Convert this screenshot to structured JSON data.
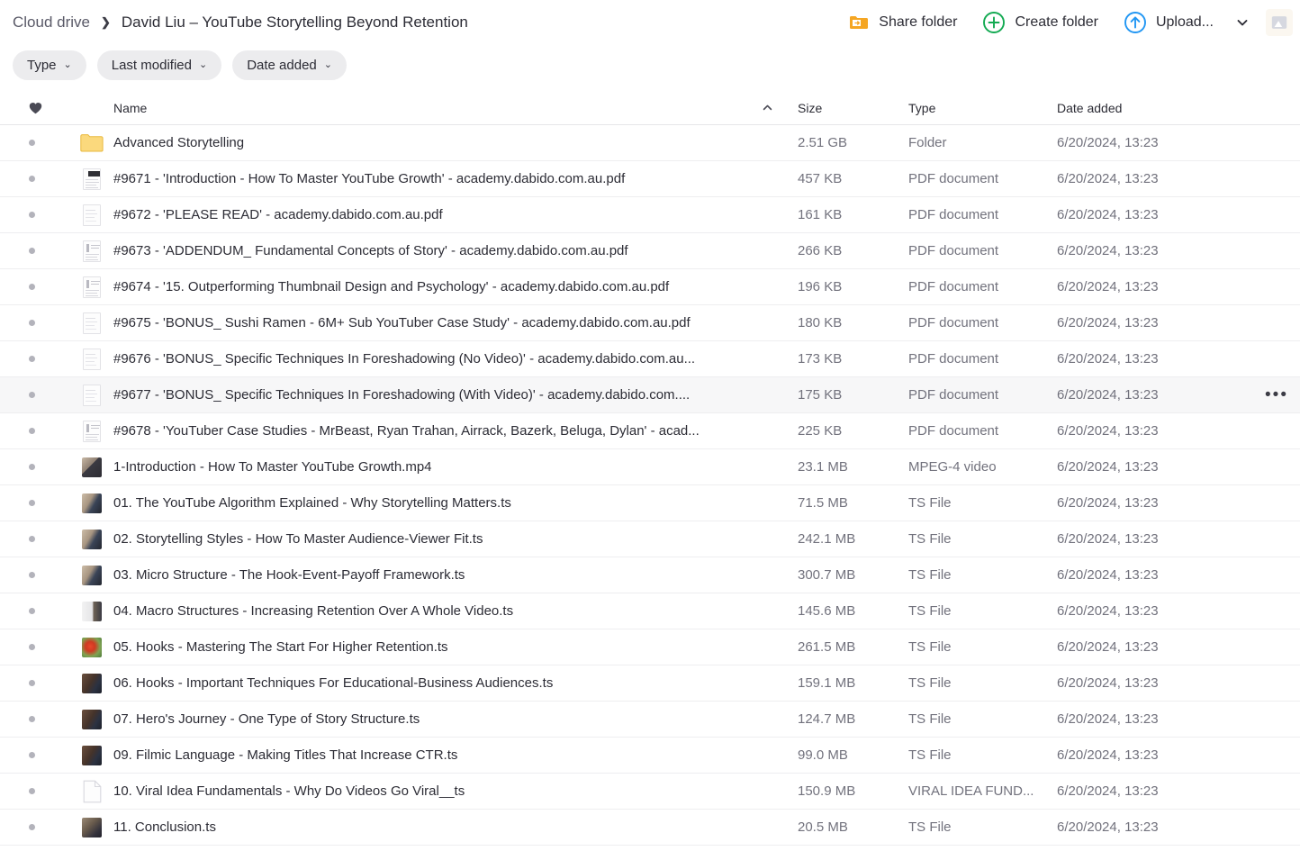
{
  "breadcrumb": {
    "root": "Cloud drive",
    "separator": "❯",
    "current": "David Liu – YouTube Storytelling Beyond Retention"
  },
  "toolbar": {
    "share_label": "Share folder",
    "create_label": "Create folder",
    "upload_label": "Upload...",
    "upload_caret": "⌄",
    "corner_icon": "image-icon",
    "icons": {
      "share": "share-folder-icon",
      "create": "plus-circle-icon",
      "upload": "upload-arrow-circle-icon"
    },
    "colors": {
      "share_accent": "#f5a623",
      "create_accent": "#13aa52",
      "upload_accent": "#2196f3"
    }
  },
  "filters": [
    {
      "label": "Type",
      "caret": "⌄",
      "name": "filter-type"
    },
    {
      "label": "Last modified",
      "caret": "⌄",
      "name": "filter-last-modified"
    },
    {
      "label": "Date added",
      "caret": "⌄",
      "name": "filter-date-added"
    }
  ],
  "table": {
    "headers": {
      "favorite_icon": "heart-icon",
      "name": "Name",
      "sort_indicator": "▲",
      "size": "Size",
      "type": "Type",
      "date_added": "Date added"
    },
    "rows": [
      {
        "name": "Advanced Storytelling",
        "size": "2.51 GB",
        "type": "Folder",
        "date": "6/20/2024, 13:23",
        "icon": "folder",
        "hovered": false
      },
      {
        "name": "#9671 - 'Introduction - How To Master YouTube Growth' - academy.dabido.com.au.pdf",
        "size": "457 KB",
        "type": "PDF document",
        "date": "6/20/2024, 13:23",
        "icon": "doc-dark",
        "hovered": false
      },
      {
        "name": "#9672 - 'PLEASE READ' - academy.dabido.com.au.pdf",
        "size": "161 KB",
        "type": "PDF document",
        "date": "6/20/2024, 13:23",
        "icon": "doc-light",
        "hovered": false
      },
      {
        "name": "#9673 - 'ADDENDUM_ Fundamental Concepts of Story' - academy.dabido.com.au.pdf",
        "size": "266 KB",
        "type": "PDF document",
        "date": "6/20/2024, 13:23",
        "icon": "doc-mid",
        "hovered": false
      },
      {
        "name": "#9674 - '15. Outperforming Thumbnail Design and Psychology' - academy.dabido.com.au.pdf",
        "size": "196 KB",
        "type": "PDF document",
        "date": "6/20/2024, 13:23",
        "icon": "doc-mid",
        "hovered": false
      },
      {
        "name": "#9675 - 'BONUS_ Sushi Ramen - 6M+ Sub YouTuber Case Study' - academy.dabido.com.au.pdf",
        "size": "180 KB",
        "type": "PDF document",
        "date": "6/20/2024, 13:23",
        "icon": "doc-light",
        "hovered": false
      },
      {
        "name": "#9676 - 'BONUS_ Specific Techniques In Foreshadowing (No Video)' - academy.dabido.com.au...",
        "size": "173 KB",
        "type": "PDF document",
        "date": "6/20/2024, 13:23",
        "icon": "doc-light",
        "hovered": false
      },
      {
        "name": "#9677 - 'BONUS_ Specific Techniques In Foreshadowing (With Video)' - academy.dabido.com....",
        "size": "175 KB",
        "type": "PDF document",
        "date": "6/20/2024, 13:23",
        "icon": "doc-light",
        "hovered": true
      },
      {
        "name": "#9678 - 'YouTuber Case Studies - MrBeast, Ryan Trahan, Airrack, Bazerk, Beluga, Dylan' - acad...",
        "size": "225 KB",
        "type": "PDF document",
        "date": "6/20/2024, 13:23",
        "icon": "doc-mid",
        "hovered": false
      },
      {
        "name": "1-Introduction - How To Master YouTube Growth.mp4",
        "size": "23.1 MB",
        "type": "MPEG-4 video",
        "date": "6/20/2024, 13:23",
        "icon": "video-a",
        "hovered": false
      },
      {
        "name": "01. The YouTube Algorithm Explained - Why Storytelling Matters.ts",
        "size": "71.5 MB",
        "type": "TS File",
        "date": "6/20/2024, 13:23",
        "icon": "video-b",
        "hovered": false
      },
      {
        "name": "02. Storytelling Styles - How To Master Audience-Viewer Fit.ts",
        "size": "242.1 MB",
        "type": "TS File",
        "date": "6/20/2024, 13:23",
        "icon": "video-b",
        "hovered": false
      },
      {
        "name": "03. Micro Structure - The Hook-Event-Payoff Framework.ts",
        "size": "300.7 MB",
        "type": "TS File",
        "date": "6/20/2024, 13:23",
        "icon": "video-b",
        "hovered": false
      },
      {
        "name": "04. Macro Structures - Increasing Retention Over A Whole Video.ts",
        "size": "145.6 MB",
        "type": "TS File",
        "date": "6/20/2024, 13:23",
        "icon": "video-white",
        "hovered": false
      },
      {
        "name": "05. Hooks - Mastering The Start For Higher Retention.ts",
        "size": "261.5 MB",
        "type": "TS File",
        "date": "6/20/2024, 13:23",
        "icon": "video-red",
        "hovered": false
      },
      {
        "name": "06. Hooks - Important Techniques For Educational-Business Audiences.ts",
        "size": "159.1 MB",
        "type": "TS File",
        "date": "6/20/2024, 13:23",
        "icon": "video-c",
        "hovered": false
      },
      {
        "name": "07. Hero's Journey - One Type of Story Structure.ts",
        "size": "124.7 MB",
        "type": "TS File",
        "date": "6/20/2024, 13:23",
        "icon": "video-c",
        "hovered": false
      },
      {
        "name": "09. Filmic Language - Making Titles That Increase CTR.ts",
        "size": "99.0 MB",
        "type": "TS File",
        "date": "6/20/2024, 13:23",
        "icon": "video-c",
        "hovered": false
      },
      {
        "name": "10. Viral Idea Fundamentals - Why Do Videos Go Viral__ts",
        "size": "150.9 MB",
        "type": "VIRAL IDEA FUND...",
        "date": "6/20/2024, 13:23",
        "icon": "blank",
        "hovered": false
      },
      {
        "name": "11. Conclusion.ts",
        "size": "20.5 MB",
        "type": "TS File",
        "date": "6/20/2024, 13:23",
        "icon": "video-d",
        "hovered": false
      }
    ],
    "row_menu_glyph": "•••",
    "favorite_marker": "•"
  }
}
